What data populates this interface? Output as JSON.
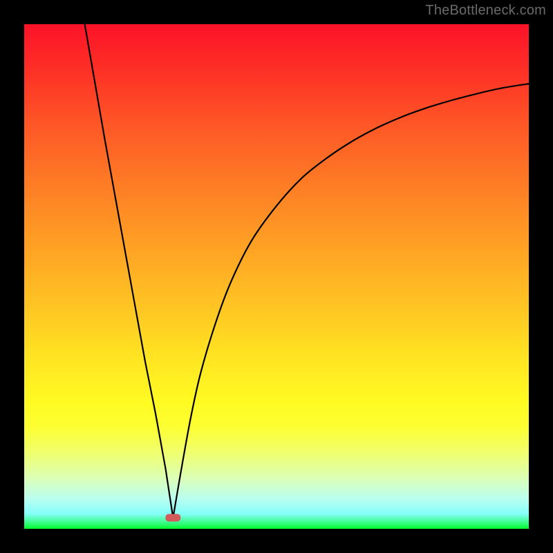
{
  "watermark": "TheBottleneck.com",
  "chart_data": {
    "type": "line",
    "title": "",
    "xlabel": "",
    "ylabel": "",
    "xlim": [
      0,
      100
    ],
    "ylim": [
      0,
      100
    ],
    "grid": false,
    "description": "V-shaped curve over vertical red-to-green gradient background; left branch descends steeply from top-left to a minimum near x≈30, right branch rises with decreasing slope toward upper-right.",
    "minimum": {
      "x": 29.5,
      "y": 2.2
    },
    "marker": {
      "x": 29.5,
      "y": 2.2,
      "color": "#d35a5a",
      "shape": "rounded-rect"
    },
    "series": [
      {
        "name": "left-branch",
        "x": [
          12,
          14,
          16,
          18,
          20,
          22,
          24,
          26,
          28,
          29.5
        ],
        "y": [
          100,
          88.5,
          77,
          66,
          55,
          44,
          33,
          23,
          12,
          2.2
        ]
      },
      {
        "name": "right-branch",
        "x": [
          29.5,
          31,
          33,
          35,
          38,
          41,
          45,
          50,
          55,
          60,
          65,
          70,
          75,
          80,
          85,
          90,
          95,
          100
        ],
        "y": [
          2.2,
          11,
          22,
          31,
          41,
          49,
          57,
          64,
          69.5,
          73.5,
          76.8,
          79.5,
          81.7,
          83.5,
          85,
          86.3,
          87.4,
          88.2
        ]
      }
    ],
    "gradient_stops": [
      {
        "pos": 0,
        "color": "#fd1228"
      },
      {
        "pos": 8,
        "color": "#fd2c26"
      },
      {
        "pos": 20,
        "color": "#fe5726"
      },
      {
        "pos": 33,
        "color": "#fe8025"
      },
      {
        "pos": 45,
        "color": "#ffa424"
      },
      {
        "pos": 57,
        "color": "#ffc823"
      },
      {
        "pos": 67,
        "color": "#ffe722"
      },
      {
        "pos": 75,
        "color": "#fffb22"
      },
      {
        "pos": 80,
        "color": "#fcff33"
      },
      {
        "pos": 85,
        "color": "#f0ff6f"
      },
      {
        "pos": 90,
        "color": "#dbffb7"
      },
      {
        "pos": 94,
        "color": "#bafff0"
      },
      {
        "pos": 97,
        "color": "#86fffb"
      },
      {
        "pos": 99,
        "color": "#2ffe79"
      },
      {
        "pos": 100,
        "color": "#02fe2a"
      }
    ]
  }
}
